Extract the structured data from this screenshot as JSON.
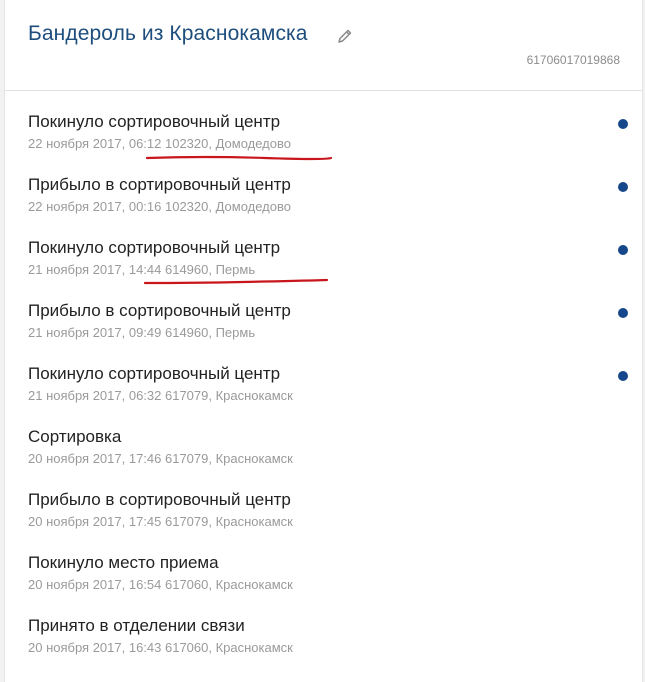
{
  "header": {
    "title": "Бандероль из Краснокамска",
    "track_number": "61706017019868"
  },
  "events": [
    {
      "title": "Покинуло сортировочный центр",
      "details": "22 ноября 2017, 06:12 102320, Домодедово",
      "status": "active"
    },
    {
      "title": "Прибыло в сортировочный центр",
      "details": "22 ноября 2017, 00:16 102320, Домодедово",
      "status": "active"
    },
    {
      "title": "Покинуло сортировочный центр",
      "details": "21 ноября 2017, 14:44 614960, Пермь",
      "status": "active"
    },
    {
      "title": "Прибыло в сортировочный центр",
      "details": "21 ноября 2017, 09:49 614960, Пермь",
      "status": "active"
    },
    {
      "title": "Покинуло сортировочный центр",
      "details": "21 ноября 2017, 06:32 617079, Краснокамск",
      "status": "active"
    },
    {
      "title": "Сортировка",
      "details": "20 ноября 2017, 17:46 617079, Краснокамск",
      "status": "none"
    },
    {
      "title": "Прибыло в сортировочный центр",
      "details": "20 ноября 2017, 17:45 617079, Краснокамск",
      "status": "none"
    },
    {
      "title": "Покинуло место приема",
      "details": "20 ноября 2017, 16:54 617060, Краснокамск",
      "status": "none"
    },
    {
      "title": "Принято в отделении связи",
      "details": "20 ноября 2017, 16:43 617060, Краснокамск",
      "status": "none"
    }
  ],
  "colors": {
    "title": "#1d4e7d",
    "status_dot": "#16478a",
    "annotation_underline": "#c8161c"
  },
  "icons": {
    "edit": "pencil-icon"
  }
}
